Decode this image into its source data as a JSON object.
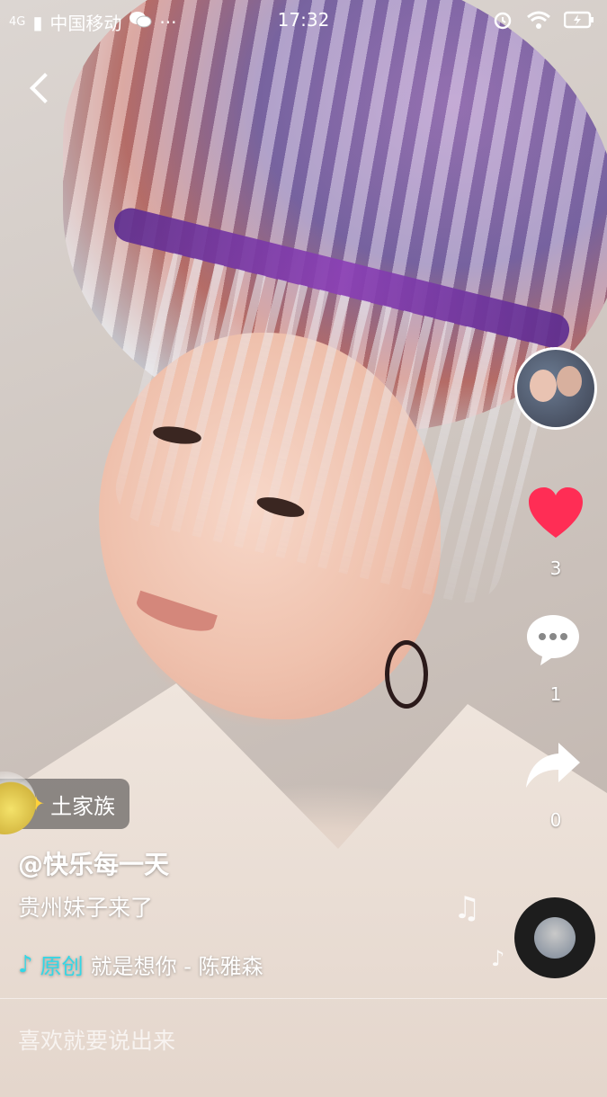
{
  "status_bar": {
    "network": "4G",
    "carrier": "中国移动",
    "dots": "···",
    "time": "17:32"
  },
  "actions": {
    "likes": "3",
    "comments": "1",
    "shares": "0"
  },
  "tag": {
    "label": "土家族"
  },
  "post": {
    "username": "@快乐每一天",
    "description": "贵州妹子来了"
  },
  "music": {
    "original_label": "原创",
    "track": "就是想你 - 陈雅森"
  },
  "comment_input": {
    "placeholder": "喜欢就要说出来"
  },
  "colors": {
    "like_red": "#ff2d55",
    "music_accent": "#32d7e6"
  }
}
